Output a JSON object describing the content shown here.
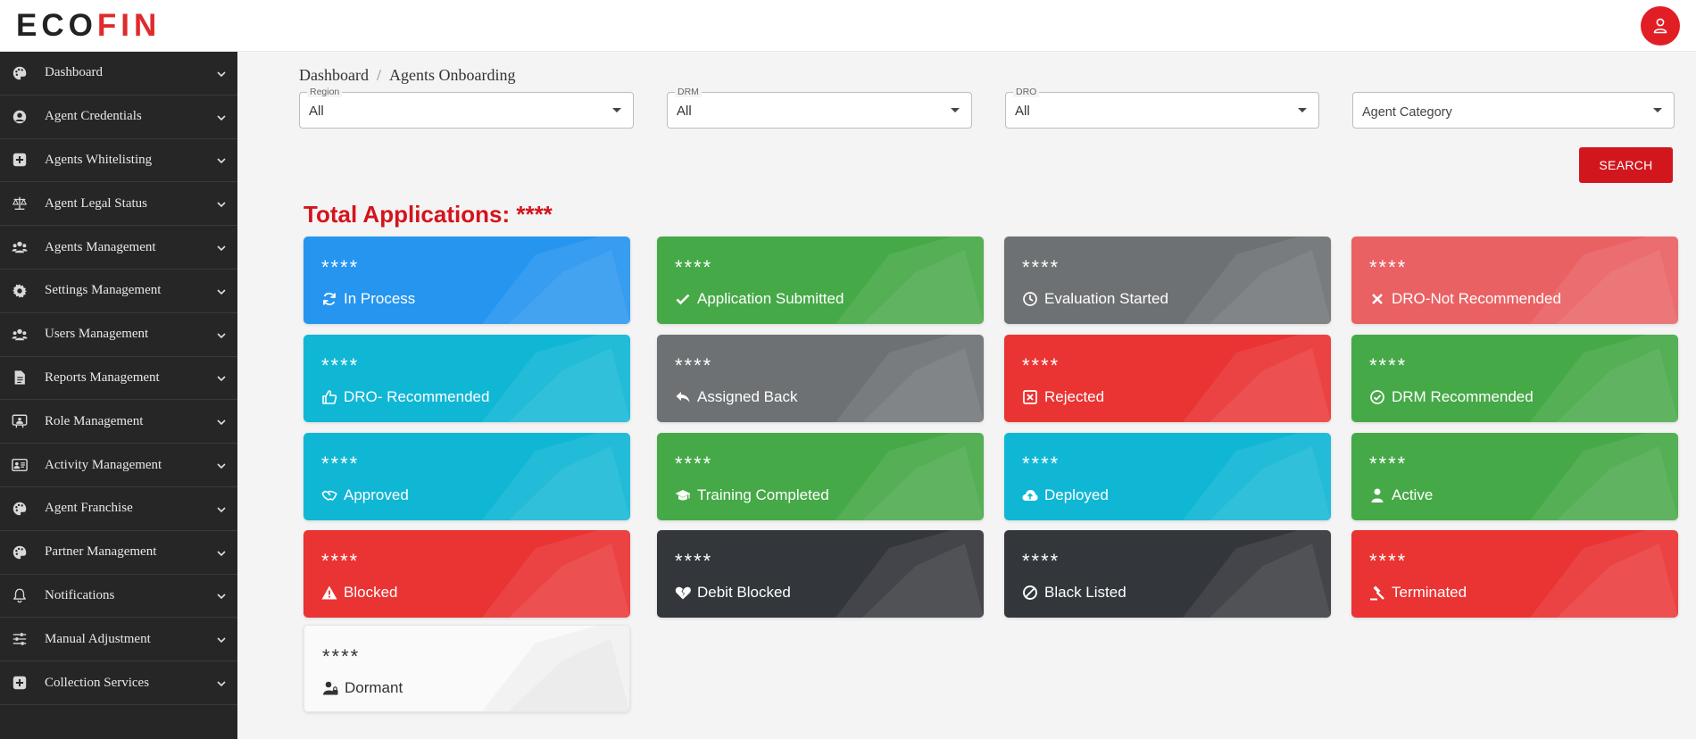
{
  "header": {
    "logo_left": "ECO",
    "logo_right": "FIN",
    "user_icon": "user-icon"
  },
  "sidebar": {
    "items": [
      {
        "label": "Dashboard",
        "icon": "palette-icon"
      },
      {
        "label": "Agent Credentials",
        "icon": "user-circle-icon"
      },
      {
        "label": "Agents Whitelisting",
        "icon": "plus-square-icon"
      },
      {
        "label": "Agent Legal Status",
        "icon": "balance-scale-icon"
      },
      {
        "label": "Agents Management",
        "icon": "users-icon"
      },
      {
        "label": "Settings Management",
        "icon": "gear-icon"
      },
      {
        "label": "Users Management",
        "icon": "users-icon"
      },
      {
        "label": "Reports Management",
        "icon": "file-icon"
      },
      {
        "label": "Role Management",
        "icon": "id-board-icon"
      },
      {
        "label": "Activity Management",
        "icon": "id-card-icon"
      },
      {
        "label": "Agent Franchise",
        "icon": "palette-icon"
      },
      {
        "label": "Partner Management",
        "icon": "palette-icon"
      },
      {
        "label": "Notifications",
        "icon": "bell-icon"
      },
      {
        "label": "Manual Adjustment",
        "icon": "sliders-icon"
      },
      {
        "label": "Collection Services",
        "icon": "plus-square-icon"
      }
    ]
  },
  "breadcrumb": {
    "root": "Dashboard",
    "separator": "/",
    "current": "Agents Onboarding"
  },
  "filters": {
    "region": {
      "label": "Region",
      "value": "All"
    },
    "drm": {
      "label": "DRM",
      "value": "All"
    },
    "dro": {
      "label": "DRO",
      "value": "All"
    },
    "agent_category": {
      "placeholder": "Agent Category"
    }
  },
  "search_label": "SEARCH",
  "total_label": "Total Applications: ****",
  "cards": [
    {
      "count": "****",
      "label": "In Process",
      "icon": "refresh-icon",
      "color": "#2595ef"
    },
    {
      "count": "****",
      "label": "Application Submitted",
      "icon": "check-icon",
      "color": "#46a947"
    },
    {
      "count": "****",
      "label": "Evaluation Started",
      "icon": "clock-icon",
      "color": "#6e7173"
    },
    {
      "count": "****",
      "label": "DRO-Not Recommended",
      "icon": "close-icon",
      "color": "#ea6163"
    },
    {
      "count": "****",
      "label": "DRO- Recommended",
      "icon": "thumbs-up-icon",
      "color": "#10b7d5"
    },
    {
      "count": "****",
      "label": "Assigned Back",
      "icon": "reply-icon",
      "color": "#6e7173"
    },
    {
      "count": "****",
      "label": "Rejected",
      "icon": "x-square-icon",
      "color": "#ea3333"
    },
    {
      "count": "****",
      "label": "DRM Recommended",
      "icon": "check-circle-icon",
      "color": "#46a947"
    },
    {
      "count": "****",
      "label": "Approved",
      "icon": "handshake-icon",
      "color": "#10b7d5"
    },
    {
      "count": "****",
      "label": "Training Completed",
      "icon": "graduation-cap-icon",
      "color": "#46a947"
    },
    {
      "count": "****",
      "label": "Deployed",
      "icon": "cloud-upload-icon",
      "color": "#10b7d5"
    },
    {
      "count": "****",
      "label": "Active",
      "icon": "user-icon",
      "color": "#46a947"
    },
    {
      "count": "****",
      "label": "Blocked",
      "icon": "warning-icon",
      "color": "#ea3333"
    },
    {
      "count": "****",
      "label": "Debit Blocked",
      "icon": "heart-broken-icon",
      "color": "#33363b"
    },
    {
      "count": "****",
      "label": "Black Listed",
      "icon": "ban-icon",
      "color": "#33363b"
    },
    {
      "count": "****",
      "label": "Terminated",
      "icon": "gavel-icon",
      "color": "#ea3333"
    },
    {
      "count": "****",
      "label": "Dormant",
      "icon": "user-lock-icon",
      "color": "#fafafa"
    }
  ]
}
